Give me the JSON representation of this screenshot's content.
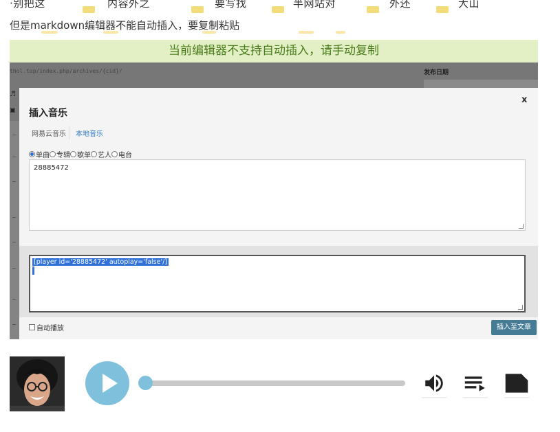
{
  "article": {
    "top_fragments": [
      "·别把这",
      "内容外之",
      "要写找",
      "半网站对",
      "外还",
      "大山"
    ],
    "caption": "但是markdown编辑器不能自动插入，要复制粘贴"
  },
  "screenshot": {
    "banner_text": "当前编辑器不支持自动插入，请手动复制",
    "background": {
      "permalink": "thol.top/index.php/archives/{cid}/",
      "publish_date_label": "发布日期",
      "side_icons": [
        "♬",
        "▣"
      ]
    },
    "modal": {
      "title": "插入音乐",
      "close_label": "x",
      "tabs": [
        {
          "label": "网易云音乐",
          "active": true
        },
        {
          "label": "本地音乐",
          "active": false
        }
      ],
      "modes": [
        {
          "label": "单曲",
          "selected": true
        },
        {
          "label": "专辑",
          "selected": false
        },
        {
          "label": "歌单",
          "selected": false
        },
        {
          "label": "艺人",
          "selected": false
        },
        {
          "label": "电台",
          "selected": false
        }
      ],
      "id_value": "28885472",
      "shortcode": "[player id='28885472' autoplay='false'/]",
      "autoplay_label": "自动播放",
      "autoplay_checked": false,
      "insert_button": "插入至文章"
    }
  },
  "player": {
    "progress": 0.0,
    "icons": [
      "play-icon",
      "volume-icon",
      "playlist-icon",
      "lyrics-icon"
    ],
    "accent_color": "#7fc1dc"
  }
}
